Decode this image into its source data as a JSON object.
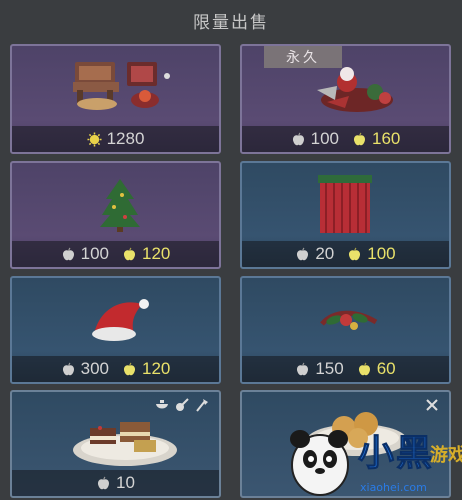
{
  "header": {
    "title": "限量出售"
  },
  "cards": [
    {
      "name": "furniture-set",
      "style": "purple",
      "badge": null,
      "prices": [
        {
          "currency": "gold-coin",
          "value": "1280",
          "color": "#e9e16a"
        }
      ]
    },
    {
      "name": "christmas-decor",
      "style": "purple",
      "badge": "永久",
      "prices": [
        {
          "currency": "silver-apple",
          "value": "100"
        },
        {
          "currency": "gold-apple",
          "value": "160"
        }
      ]
    },
    {
      "name": "christmas-tree",
      "style": "purple",
      "badge": null,
      "prices": [
        {
          "currency": "silver-apple",
          "value": "100"
        },
        {
          "currency": "gold-apple",
          "value": "120"
        }
      ]
    },
    {
      "name": "red-curtain",
      "style": "blue",
      "badge": null,
      "prices": [
        {
          "currency": "silver-apple",
          "value": "20"
        },
        {
          "currency": "gold-apple",
          "value": "100"
        }
      ]
    },
    {
      "name": "santa-hat",
      "style": "blue",
      "badge": null,
      "prices": [
        {
          "currency": "silver-apple",
          "value": "300"
        },
        {
          "currency": "gold-apple",
          "value": "120"
        }
      ]
    },
    {
      "name": "holly-wreath",
      "style": "blue",
      "badge": null,
      "prices": [
        {
          "currency": "silver-apple",
          "value": "150"
        },
        {
          "currency": "gold-apple",
          "value": "60"
        }
      ]
    },
    {
      "name": "cake-plate",
      "style": "gray",
      "badge": null,
      "prices": [
        {
          "currency": "silver-apple",
          "value": "10"
        }
      ]
    },
    {
      "name": "cookie-plate",
      "style": "gray",
      "badge": null,
      "prices": []
    }
  ],
  "watermark": {
    "brand": "小黑游戏",
    "url": "xiaohei.com"
  },
  "colors": {
    "gold": "#e9e16a",
    "silver": "#cfcfcf",
    "accent_red": "#c23a3a"
  }
}
